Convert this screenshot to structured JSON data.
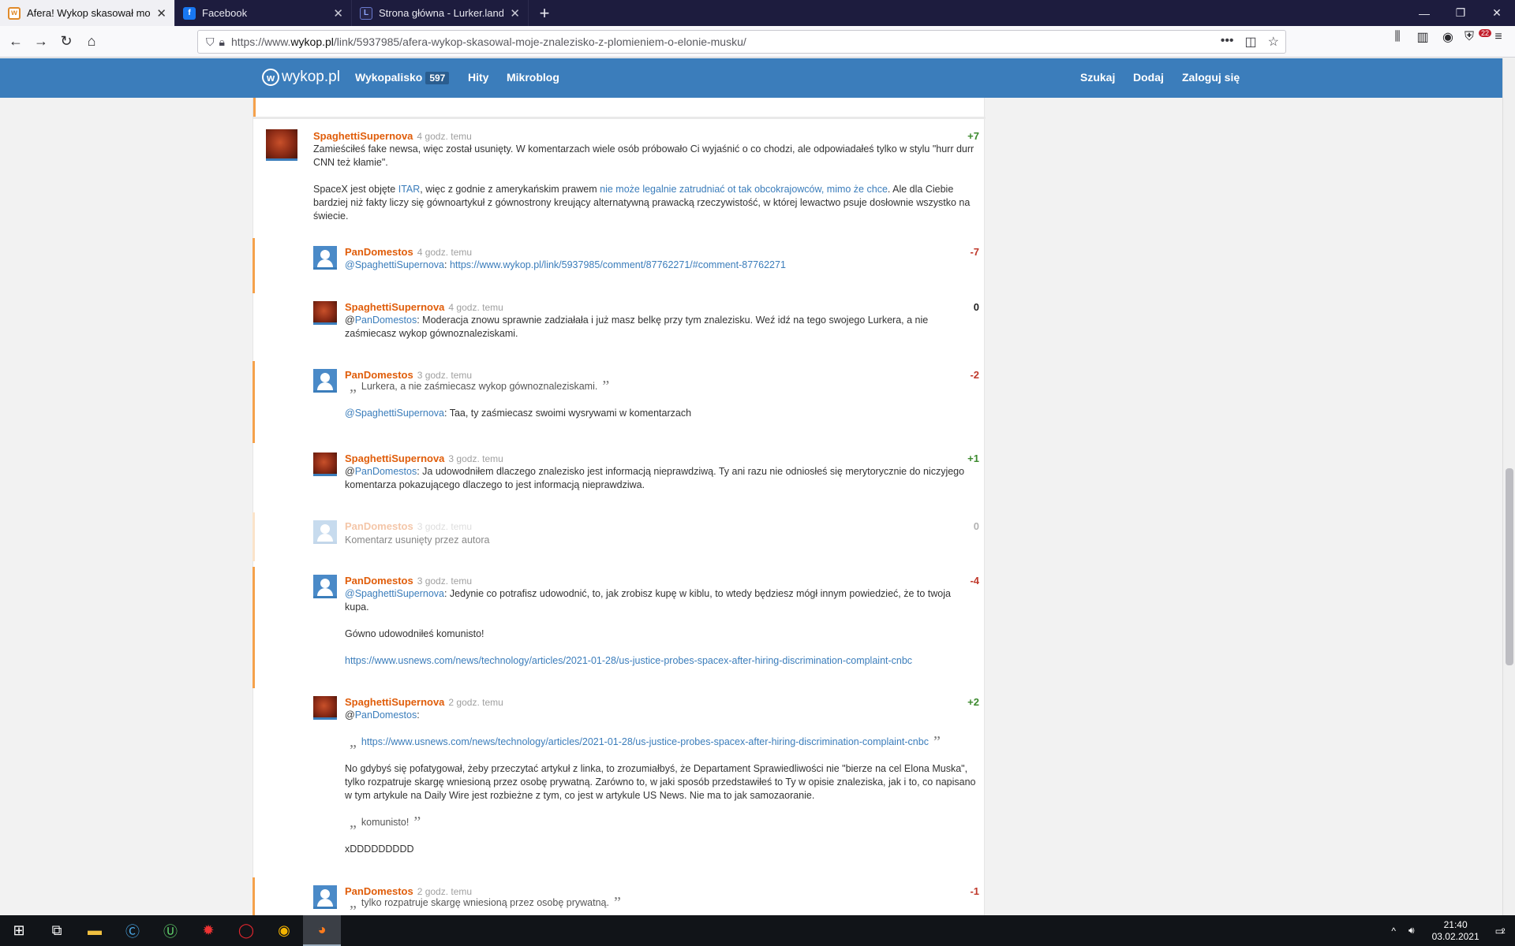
{
  "browser": {
    "tabs": [
      {
        "title": "Afera! Wykop skasował moje zn",
        "active": true
      },
      {
        "title": "Facebook",
        "active": false
      },
      {
        "title": "Strona główna - Lurker.land",
        "active": false
      }
    ],
    "url_prefix": "https://www.",
    "url_domain": "wykop.pl",
    "url_path": "/link/5937985/afera-wykop-skasowal-moje-znalezisko-z-plomieniem-o-elonie-musku/",
    "ext_badge": "22"
  },
  "site": {
    "logo": "wykop.pl",
    "nav": {
      "wykopalisko": "Wykopalisko",
      "wykopalisko_count": "597",
      "hity": "Hity",
      "mikroblog": "Mikroblog"
    },
    "right": {
      "search": "Szukaj",
      "add": "Dodaj",
      "login": "Zaloguj się"
    }
  },
  "comments": [
    {
      "user": "SpaghettiSupernova",
      "time": "4 godz. temu",
      "vote": "+7",
      "p1": "Zamieściłeś fake newsa, więc został usunięty. W komentarzach wiele osób próbowało Ci wyjaśnić o co chodzi, ale odpowiadałeś tylko w stylu \"hurr durr CNN też kłamie\".",
      "p2a": "SpaceX jest objęte ",
      "p2link1": "ITAR",
      "p2b": ", więc z godnie z amerykańskim prawem ",
      "p2link2": "nie może legalnie zatrudniać ot tak obcokrajowców, mimo że chce",
      "p2c": ". Ale dla Ciebie bardziej niż fakty liczy się gównoartykuł z gównostrony kreujący alternatywną prawacką rzeczywistość, w której lewactwo psuje dosłownie wszystko na świecie."
    },
    {
      "user": "PanDomestos",
      "time": "4 godz. temu",
      "vote": "-7",
      "mention": "@SpaghettiSupernova",
      "sep": ": ",
      "link": "https://www.wykop.pl/link/5937985/comment/87762271/#comment-87762271"
    },
    {
      "user": "SpaghettiSupernova",
      "time": "4 godz. temu",
      "vote": "0",
      "mention_at": "@",
      "mention": "PanDomestos",
      "text": ": Moderacja znowu sprawnie zadziałała i już masz belkę przy tym znalezisku. Weź idź na tego swojego Lurkera, a nie zaśmiecasz wykop gównoznaleziskami."
    },
    {
      "user": "PanDomestos",
      "time": "3 godz. temu",
      "vote": "-2",
      "quote": "Lurkera, a nie zaśmiecasz wykop gównoznaleziskami.",
      "mention": "@SpaghettiSupernova",
      "text": ": Taa, ty zaśmiecasz swoimi wysrywami w komentarzach"
    },
    {
      "user": "SpaghettiSupernova",
      "time": "3 godz. temu",
      "vote": "+1",
      "mention_at": "@",
      "mention": "PanDomestos",
      "text": ": Ja udowodniłem dlaczego znalezisko jest informacją nieprawdziwą. Ty ani razu nie odniosłeś się merytorycznie do niczyjego komentarza pokazującego dlaczego to jest informacją nieprawdziwa."
    },
    {
      "user": "PanDomestos",
      "time": "3 godz. temu",
      "vote": "0",
      "text": "Komentarz usunięty przez autora"
    },
    {
      "user": "PanDomestos",
      "time": "3 godz. temu",
      "vote": "-4",
      "mention": "@SpaghettiSupernova",
      "text": ": Jedynie co potrafisz udowodnić, to, jak zrobisz kupę w kiblu, to wtedy będziesz mógł innym powiedzieć, że to twoja kupa.",
      "p2": "Gówno udowodniłeś komunisto!",
      "link": "https://www.usnews.com/news/technology/articles/2021-01-28/us-justice-probes-spacex-after-hiring-discrimination-complaint-cnbc"
    },
    {
      "user": "SpaghettiSupernova",
      "time": "2 godz. temu",
      "vote": "+2",
      "mention_at": "@",
      "mention": "PanDomestos",
      "colon": ":",
      "quote_link": "https://www.usnews.com/news/technology/articles/2021-01-28/us-justice-probes-spacex-after-hiring-discrimination-complaint-cnbc",
      "p2": "No gdybyś się pofatygował, żeby przeczytać artykuł z linka, to zrozumiałbyś, że Departament Sprawiedliwości nie \"bierze na cel Elona Muska\", tylko rozpatruje skargę wniesioną przez osobę prywatną. Zarówno to, w jaki sposób przedstawiłeś to Ty w opisie znaleziska, jak i to, co napisano w tym artykule na Daily Wire jest rozbieżne z tym, co jest w artykule US News. Nie ma to jak samozaoranie.",
      "quote2": "komunisto!",
      "p3": "xDDDDDDDDD"
    },
    {
      "user": "PanDomestos",
      "time": "2 godz. temu",
      "vote": "-1",
      "quote": "tylko rozpatruje skargę wniesioną przez osobę prywatną."
    }
  ],
  "taskbar": {
    "time": "21:40",
    "date": "03.02.2021",
    "notif": "2"
  }
}
